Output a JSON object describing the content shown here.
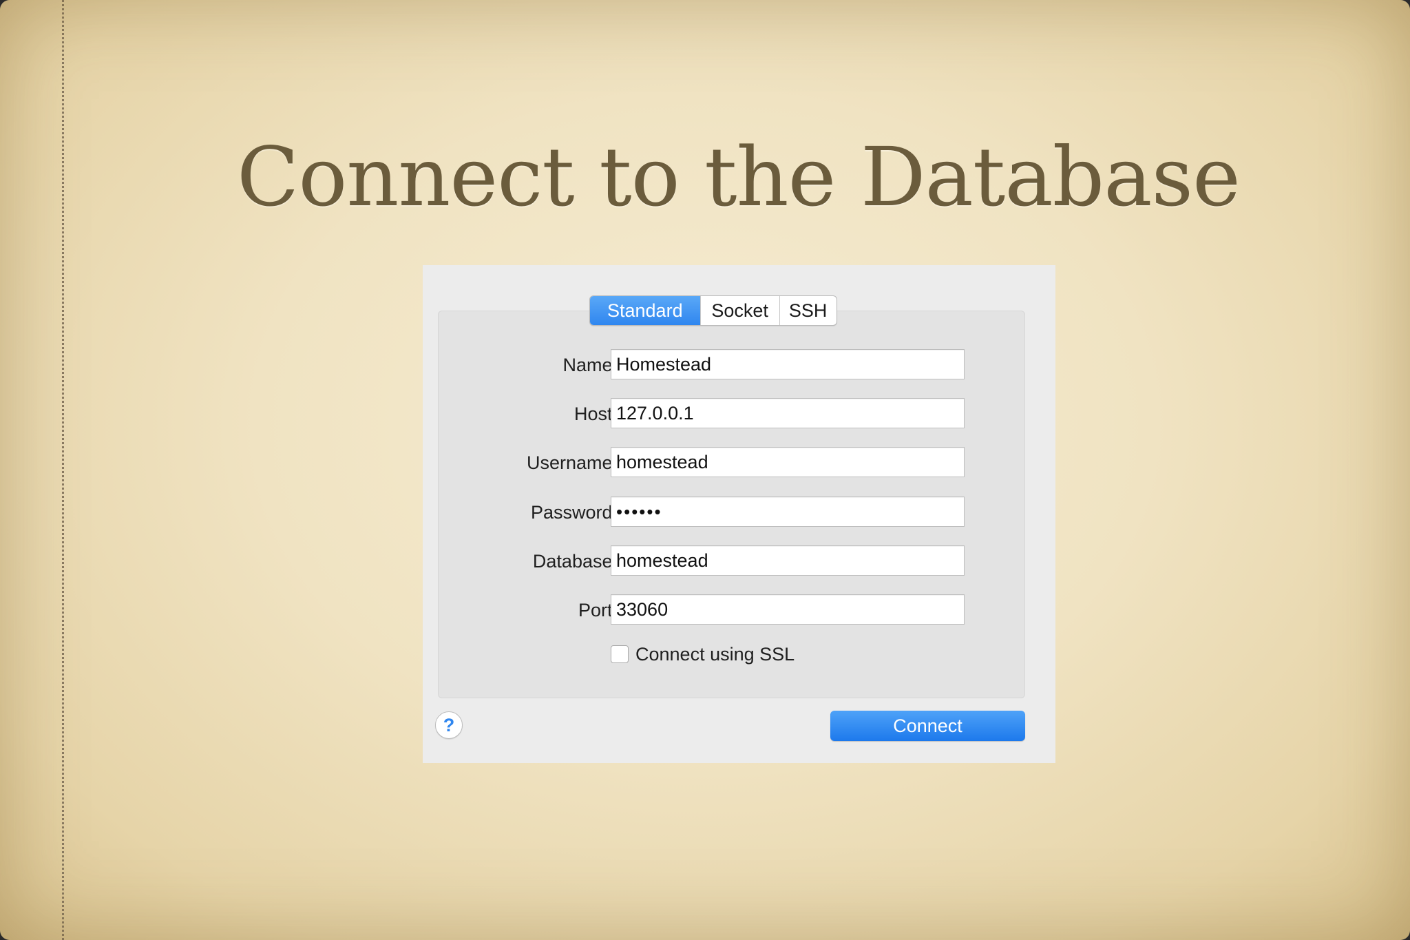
{
  "slide": {
    "title": "Connect to the Database"
  },
  "dialog": {
    "tabs": [
      {
        "label": "Standard",
        "active": true
      },
      {
        "label": "Socket",
        "active": false
      },
      {
        "label": "SSH",
        "active": false
      }
    ],
    "fields": {
      "name": {
        "label": "Name:",
        "value": "Homestead"
      },
      "host": {
        "label": "Host:",
        "value": "127.0.0.1"
      },
      "username": {
        "label": "Username:",
        "value": "homestead"
      },
      "password": {
        "label": "Password:",
        "value": "••••••"
      },
      "database": {
        "label": "Database:",
        "value": "homestead"
      },
      "port": {
        "label": "Port:",
        "value": "33060"
      }
    },
    "ssl": {
      "label": "Connect using SSL",
      "checked": false
    },
    "help_label": "?",
    "connect_label": "Connect",
    "accent_color": "#2f86ef"
  }
}
